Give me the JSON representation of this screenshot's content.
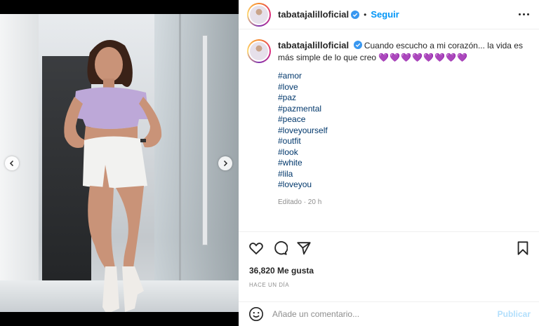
{
  "post": {
    "username": "tabatajalilloficial",
    "follow_label": "Seguir",
    "dot": "•"
  },
  "caption": {
    "username": "tabatajalilloficial",
    "text": "Cuando escucho a mi corazón... la vida es más simple de lo que creo",
    "hearts": "💜💜💜💜💜💜💜💜",
    "hashtags": [
      "#amor",
      "#love",
      "#paz",
      "#pazmental",
      "#peace",
      "#loveyourself",
      "#outfit",
      "#look",
      "#white",
      "#lila",
      "#loveyou"
    ],
    "edited": "Editado · 20 h"
  },
  "stats": {
    "likes": "36,820 Me gusta",
    "time": "HACE UN DÍA"
  },
  "comment_box": {
    "placeholder": "Añade un comentario...",
    "publish_label": "Publicar"
  },
  "icons": {
    "like": "heart-icon",
    "comment": "comment-icon",
    "share": "share-icon",
    "save": "bookmark-icon",
    "emoji": "emoji-icon",
    "prev": "chevron-left-icon",
    "next": "chevron-right-icon",
    "verified": "verified-badge-icon"
  },
  "colors": {
    "accent": "#0095f6",
    "hashtag": "#00376b",
    "verified": "#3897f0",
    "publish_disabled": "#b2dffc"
  }
}
